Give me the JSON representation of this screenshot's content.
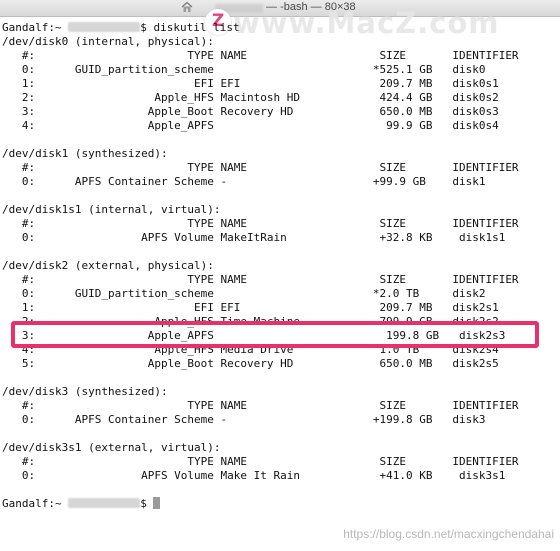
{
  "window": {
    "title": " — -bash — 80×38",
    "watermark": "www.MacZ.com",
    "watermark_logo": "Z"
  },
  "terminal": {
    "command_line": "Gandalf:~ ",
    "command": "$ diskutil list",
    "lines": [
      "/dev/disk0 (internal, physical):",
      "   #:                       TYPE NAME                    SIZE       IDENTIFIER",
      "   0:      GUID_partition_scheme                        *525.1 GB   disk0",
      "   1:                        EFI EFI                     209.7 MB   disk0s1",
      "   2:                  Apple_HFS Macintosh HD            424.4 GB   disk0s2",
      "   3:                 Apple_Boot Recovery HD             650.0 MB   disk0s3",
      "   4:                 Apple_APFS                          99.9 GB   disk0s4",
      "",
      "/dev/disk1 (synthesized):",
      "   #:                       TYPE NAME                    SIZE       IDENTIFIER",
      "   0:      APFS Container Scheme -                      +99.9 GB    disk1",
      "",
      "/dev/disk1s1 (internal, virtual):",
      "   #:                       TYPE NAME                    SIZE       IDENTIFIER",
      "   0:                APFS Volume MakeItRain              +32.8 KB    disk1s1",
      "",
      "/dev/disk2 (external, physical):",
      "   #:                       TYPE NAME                    SIZE       IDENTIFIER",
      "   0:      GUID_partition_scheme                        *2.0 TB     disk2",
      "   1:                        EFI EFI                     209.7 MB   disk2s1",
      "   2:                  Apple_HFS Time Machine            799.9 GB   disk2s2",
      "   3:                 Apple_APFS                          199.8 GB   disk2s3",
      "   4:                  Apple_HFS Media Drive             1.0 TB     disk2s4",
      "   5:                 Apple_Boot Recovery HD             650.0 MB   disk2s5",
      "",
      "/dev/disk3 (synthesized):",
      "   #:                       TYPE NAME                    SIZE       IDENTIFIER",
      "   0:      APFS Container Scheme -                      +199.8 GB   disk3",
      "",
      "/dev/disk3s1 (external, virtual):",
      "   #:                       TYPE NAME                    SIZE       IDENTIFIER",
      "   0:                APFS Volume Make It Rain            +41.0 KB    disk3s1",
      "",
      "Gandalf:~ "
    ],
    "prompt_end": "$ "
  },
  "highlight_color": "#e8306a",
  "footer": "https://blog.csdn.net/macxingchendahai"
}
